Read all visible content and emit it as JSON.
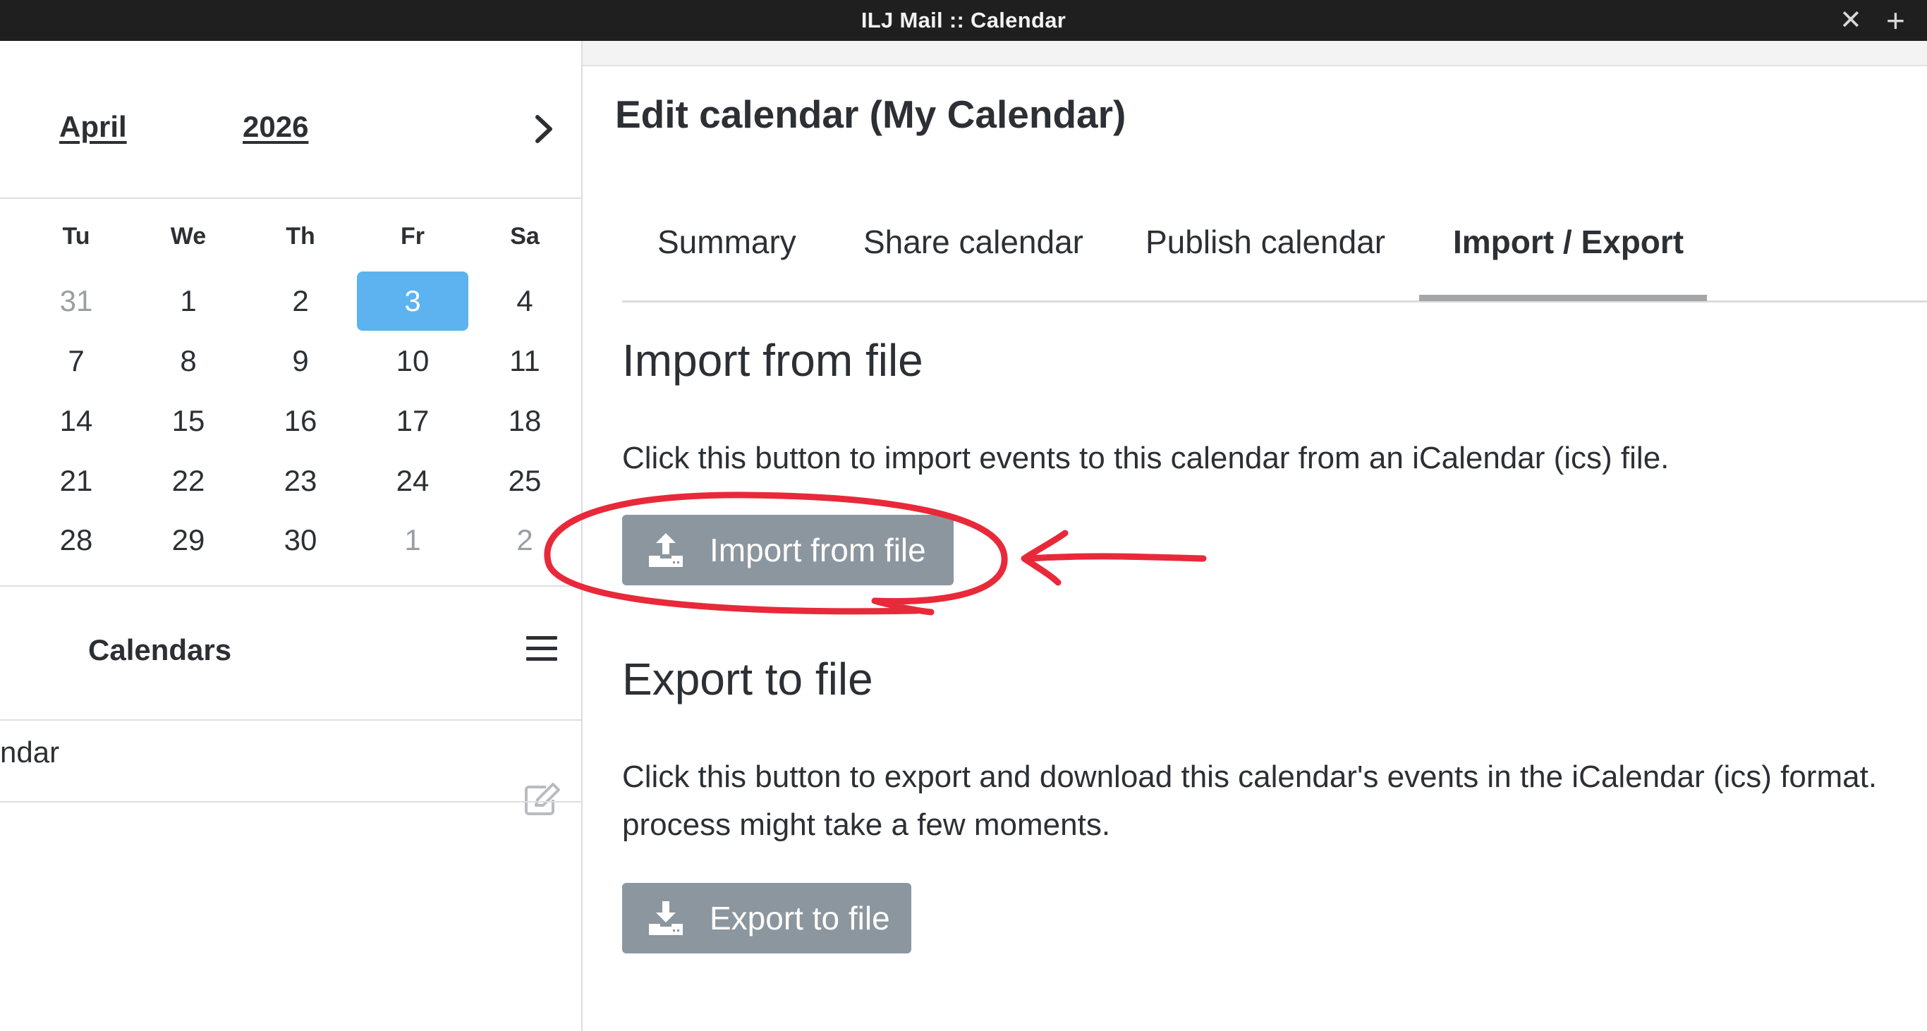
{
  "window": {
    "title": "ILJ Mail :: Calendar",
    "close_symbol": "✕",
    "new_tab_symbol": "+"
  },
  "mini_calendar": {
    "month": "April",
    "year": "2026",
    "next_icon": "chevron-right-icon",
    "weekday_headers": [
      "Tu",
      "We",
      "Th",
      "Fr",
      "Sa"
    ],
    "weeks": [
      [
        "31",
        "1",
        "2",
        "3",
        "4"
      ],
      [
        "7",
        "8",
        "9",
        "10",
        "11"
      ],
      [
        "14",
        "15",
        "16",
        "17",
        "18"
      ],
      [
        "21",
        "22",
        "23",
        "24",
        "25"
      ],
      [
        "28",
        "29",
        "30",
        "1",
        "2"
      ]
    ],
    "selected_day": "3",
    "selected_color": "#5cb3f0"
  },
  "calendars": {
    "heading": "Calendars",
    "menu_icon": "hamburger-menu-icon",
    "items": [
      {
        "label": "ndar",
        "edit_icon": "edit-icon"
      }
    ]
  },
  "main": {
    "title": "Edit calendar (My Calendar)",
    "tabs": [
      {
        "label": "Summary",
        "active": false
      },
      {
        "label": "Share calendar",
        "active": false
      },
      {
        "label": "Publish calendar",
        "active": false
      },
      {
        "label": "Import / Export",
        "active": true
      }
    ],
    "import": {
      "heading": "Import from file",
      "description": "Click this button to import events to this calendar from an iCalendar (ics) file.",
      "button_label": "Import from file",
      "button_icon": "upload-icon"
    },
    "export": {
      "heading": "Export to file",
      "description_line1": "Click this button to export and download this calendar's events in the iCalendar (ics) format.",
      "description_line2": "process might take a few moments.",
      "button_label": "Export to file",
      "button_icon": "download-icon"
    }
  },
  "colors": {
    "button_bg": "#8c969e",
    "annotation_red": "#e8293a"
  }
}
